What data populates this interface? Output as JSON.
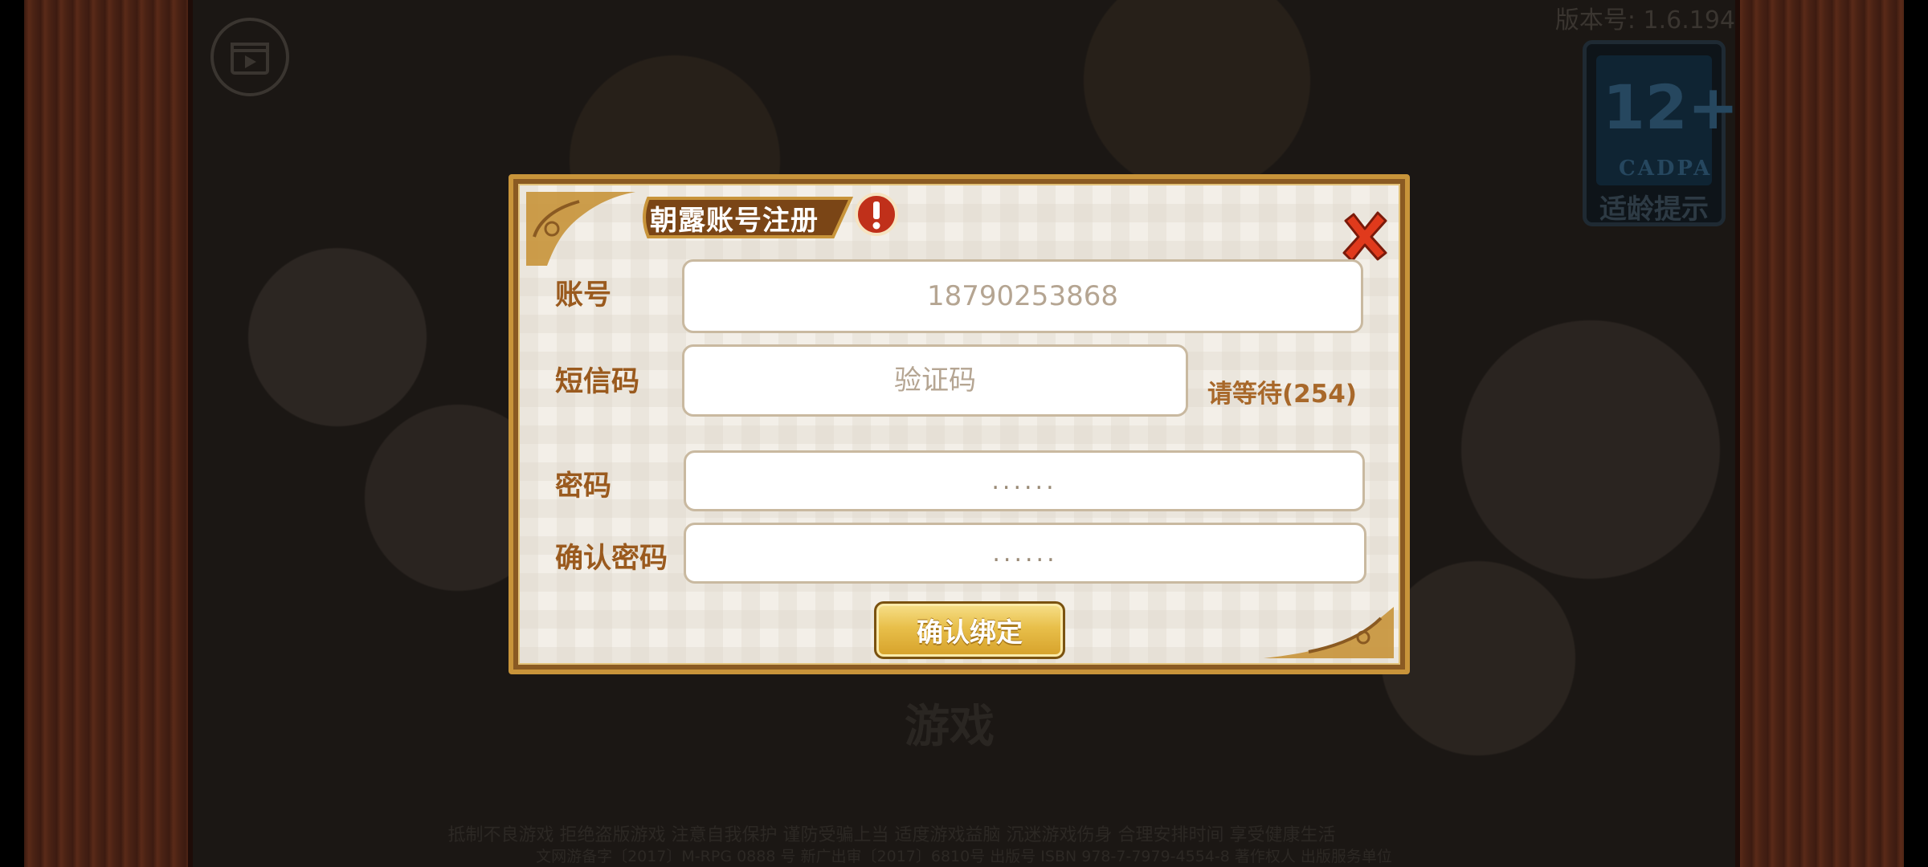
{
  "background": {
    "version_text": "版本号: 1.6.194",
    "age_rating": {
      "number": "12+",
      "org": "CADPA",
      "tip": "适龄提示"
    },
    "game_logo_text": "游戏",
    "footer_line1": "抵制不良游戏 拒绝盗版游戏 注意自我保护 谨防受骗上当 适度游戏益脑 沉迷游戏伤身 合理安排时间 享受健康生活",
    "footer_line2": "文网游备字〔2017〕M-RPG 0888 号 新广出审〔2017〕6810号 出版号 ISBN 978-7-7979-4554-8 著作权人 出版服务单位"
  },
  "dialog": {
    "title": "朝露账号注册",
    "labels": {
      "account": "账号",
      "sms": "短信码",
      "password": "密码",
      "confirm_password": "确认密码"
    },
    "account_value": "18790253868",
    "sms_placeholder": "验证码",
    "wait_text": "请等待(254)",
    "password_mask": "......",
    "confirm_password_mask": "......",
    "confirm_button": "确认绑定"
  },
  "colors": {
    "label": "#9a5a1e",
    "button_gold": "#e8bf4a",
    "close_red": "#e03a1c",
    "warn_red": "#c0301a"
  }
}
